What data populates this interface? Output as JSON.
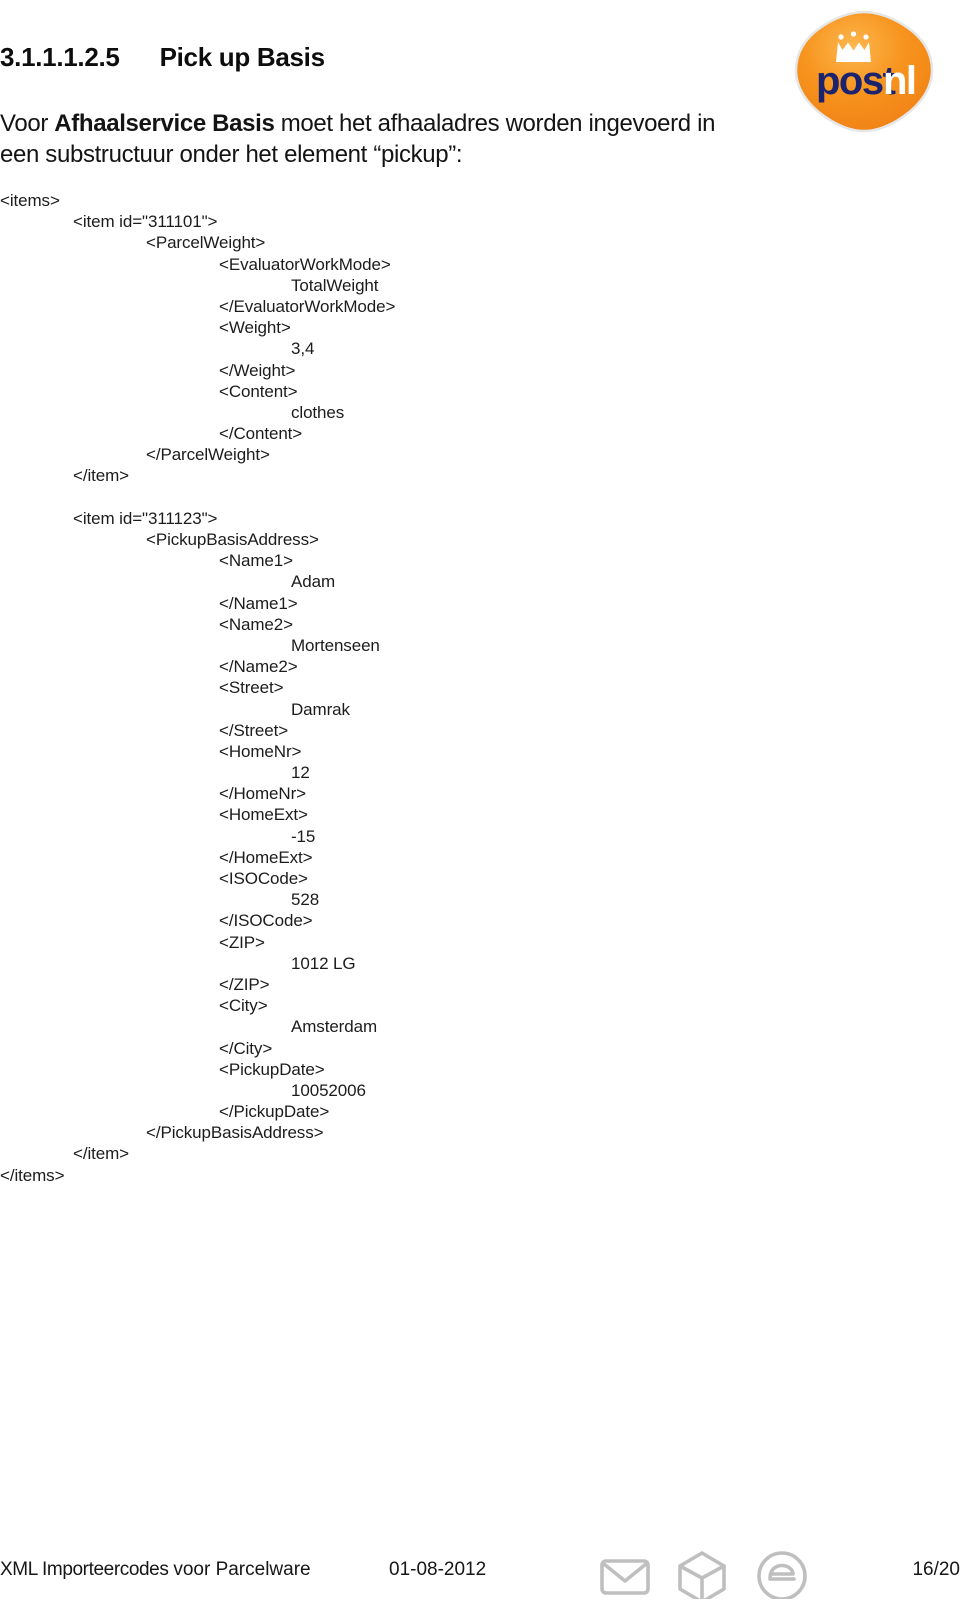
{
  "document": {
    "heading_number": "3.1.1.1.2.5",
    "heading_title": "Pick up Basis",
    "intro_before": "Voor ",
    "intro_bold": "Afhaalservice Basis",
    "intro_after": " moet het afhaaladres worden ingevoerd in een substructuur onder het element “pickup”:"
  },
  "logo": {
    "wordmark_dark": "post",
    "wordmark_light": "nl",
    "crown_icon": "crown-icon",
    "orange": "#F68B1F",
    "orange_light": "#FBAE40",
    "navy": "#1B226E",
    "white": "#FFFFFF"
  },
  "code": {
    "lines": [
      {
        "indent": 0,
        "text": "<items>"
      },
      {
        "indent": 1,
        "text": "<item id=\"311101\">"
      },
      {
        "indent": 2,
        "text": "<ParcelWeight>"
      },
      {
        "indent": 3,
        "text": "<EvaluatorWorkMode>"
      },
      {
        "indent": 4,
        "text": "TotalWeight"
      },
      {
        "indent": 3,
        "text": "</EvaluatorWorkMode>"
      },
      {
        "indent": 3,
        "text": "<Weight>"
      },
      {
        "indent": 4,
        "text": "3,4"
      },
      {
        "indent": 3,
        "text": "</Weight>"
      },
      {
        "indent": 3,
        "text": "<Content>"
      },
      {
        "indent": 4,
        "text": "clothes"
      },
      {
        "indent": 3,
        "text": "</Content>"
      },
      {
        "indent": 2,
        "text": "</ParcelWeight>"
      },
      {
        "indent": 1,
        "text": "</item>"
      },
      {
        "indent": 0,
        "text": "",
        "blank": true
      },
      {
        "indent": 1,
        "text": "<item id=\"311123\">"
      },
      {
        "indent": 2,
        "text": "<PickupBasisAddress>"
      },
      {
        "indent": 3,
        "text": "<Name1>"
      },
      {
        "indent": 4,
        "text": "Adam"
      },
      {
        "indent": 3,
        "text": "</Name1>"
      },
      {
        "indent": 3,
        "text": "<Name2>"
      },
      {
        "indent": 4,
        "text": "Mortenseen"
      },
      {
        "indent": 3,
        "text": "</Name2>"
      },
      {
        "indent": 3,
        "text": "<Street>"
      },
      {
        "indent": 4,
        "text": "Damrak"
      },
      {
        "indent": 3,
        "text": "</Street>"
      },
      {
        "indent": 3,
        "text": "<HomeNr>"
      },
      {
        "indent": 4,
        "text": "12"
      },
      {
        "indent": 3,
        "text": "</HomeNr>"
      },
      {
        "indent": 3,
        "text": "<HomeExt>"
      },
      {
        "indent": 4,
        "text": "-15"
      },
      {
        "indent": 3,
        "text": "</HomeExt>"
      },
      {
        "indent": 3,
        "text": "<ISOCode>"
      },
      {
        "indent": 4,
        "text": "528"
      },
      {
        "indent": 3,
        "text": "</ISOCode>"
      },
      {
        "indent": 3,
        "text": "<ZIP>"
      },
      {
        "indent": 4,
        "text": "1012 LG"
      },
      {
        "indent": 3,
        "text": "</ZIP>"
      },
      {
        "indent": 3,
        "text": "<City>"
      },
      {
        "indent": 4,
        "text": "Amsterdam"
      },
      {
        "indent": 3,
        "text": "</City>"
      },
      {
        "indent": 3,
        "text": "<PickupDate>"
      },
      {
        "indent": 4,
        "text": "10052006"
      },
      {
        "indent": 3,
        "text": "</PickupDate>"
      },
      {
        "indent": 2,
        "text": "</PickupBasisAddress>"
      },
      {
        "indent": 1,
        "text": "</item>"
      },
      {
        "indent": 0,
        "text": "</items>"
      }
    ]
  },
  "footer": {
    "doc_title_part1": "XML Importeercodes ",
    "doc_title_part2": "voor Parcelware",
    "date": "01-08-2012",
    "page": "16/20",
    "icons": [
      {
        "name": "envelope-icon"
      },
      {
        "name": "parcel-box-icon"
      },
      {
        "name": "e-commerce-icon"
      }
    ],
    "icon_color": "#BFBFBF"
  }
}
